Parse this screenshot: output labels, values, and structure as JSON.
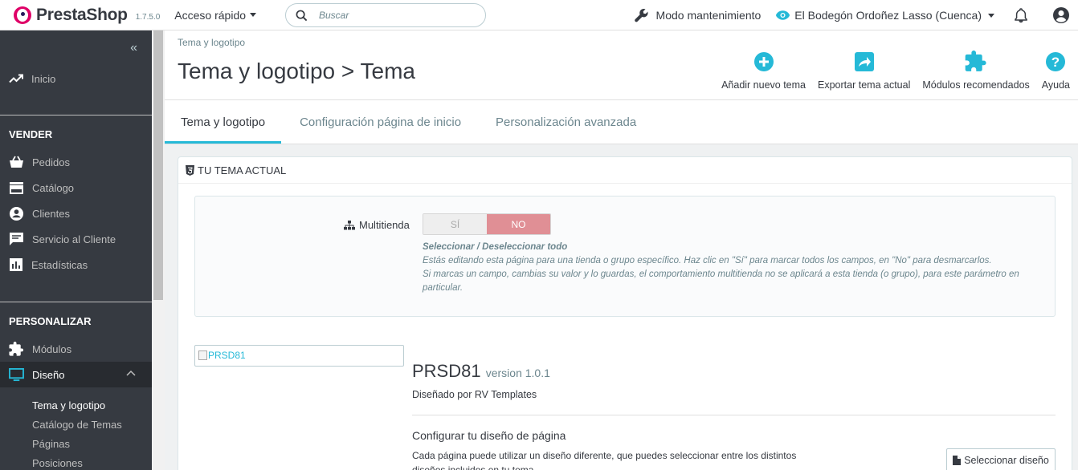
{
  "brand": {
    "logo_text": "PrestaShop",
    "version": "1.7.5.0"
  },
  "topbar": {
    "quick_access": "Acceso rápido",
    "search_placeholder": "Buscar",
    "maintenance": "Modo mantenimiento",
    "shop_name": "El Bodegón Ordoñez Lasso (Cuenca)"
  },
  "sidebar": {
    "collapse_label": "«",
    "home": "Inicio",
    "sell_section": "VENDER",
    "sell_items": [
      "Pedidos",
      "Catálogo",
      "Clientes",
      "Servicio al Cliente",
      "Estadísticas"
    ],
    "customize_section": "PERSONALIZAR",
    "modules": "Módulos",
    "design": "Diseño",
    "design_sub": [
      "Tema y logotipo",
      "Catálogo de Temas",
      "Páginas",
      "Posiciones"
    ]
  },
  "header": {
    "breadcrumb": "Tema y logotipo",
    "title": "Tema y logotipo > Tema",
    "tools": [
      "Añadir nuevo tema",
      "Exportar tema actual",
      "Módulos recomendados",
      "Ayuda"
    ]
  },
  "tabs": [
    "Tema y logotipo",
    "Configuración página de inicio",
    "Personalización avanzada"
  ],
  "panel": {
    "heading": "TU TEMA ACTUAL",
    "multistore": {
      "label": "Multitienda",
      "yes": "SÍ",
      "no": "NO",
      "selected": "NO",
      "help_title": "Seleccionar / Deseleccionar todo",
      "help_line1": "Estás editando esta página para una tienda o grupo específico. Haz clic en \"Sí\" para marcar todos los campos, en \"No\" para desmarcarlos.",
      "help_line2": "Si marcas un campo, cambias su valor y lo guardas, el comportamiento multitienda no se aplicará a esta tienda (o grupo), para este parámetro en particular."
    },
    "theme": {
      "image_alt": "PRSD81",
      "name": "PRSD81",
      "version": "version 1.0.1",
      "designed_by": "Diseñado por RV Templates"
    },
    "layout": {
      "title": "Configurar tu diseño de página",
      "text": "Cada página puede utilizar un diseño diferente, que puedes seleccionar entre los distintos diseños incluidos en tu tema.",
      "button": "Seleccionar diseño"
    }
  },
  "colors": {
    "accent": "#25b9d7",
    "sidebar": "#363a41",
    "brand": "#df0067",
    "no_switch": "#e08f95"
  }
}
